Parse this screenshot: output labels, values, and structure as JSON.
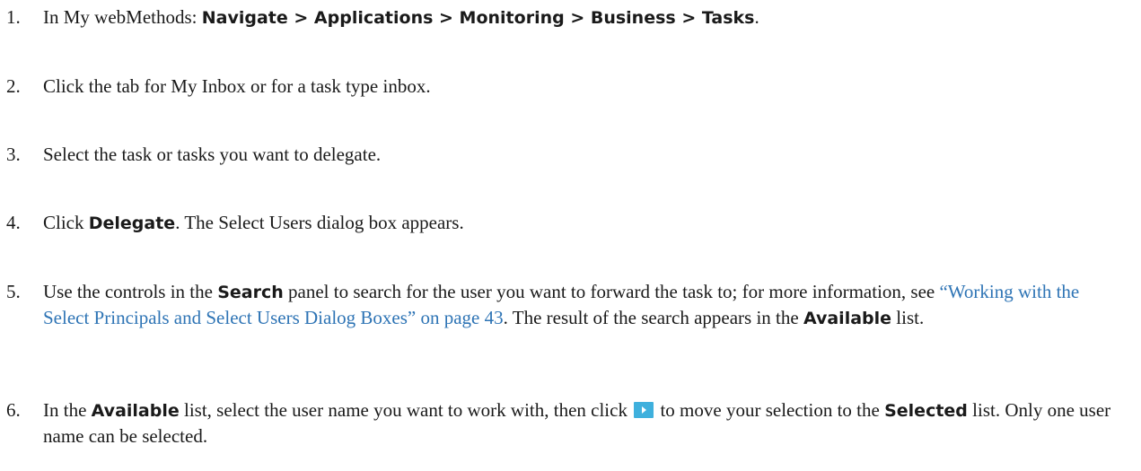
{
  "steps": [
    {
      "num": "1.",
      "t1": "In My webMethods: ",
      "path": "Navigate > Applications > Monitoring > Business > Tasks",
      "t2": "."
    },
    {
      "num": "2.",
      "t1": "Click the tab for My Inbox or for a task type inbox."
    },
    {
      "num": "3.",
      "t1": "Select the task or tasks you want to delegate."
    },
    {
      "num": "4.",
      "t1": "Click ",
      "ui1": "Delegate",
      "t2": ". The Select Users dialog box appears."
    },
    {
      "num": "5.",
      "t1": "Use the controls in the ",
      "ui1": "Search",
      "t2": " panel to search for the user you want to forward the task to; for more information, see ",
      "link": "“Working with the Select Principals and Select Users Dialog Boxes” on page 43",
      "t3": ". The result of the search appears in the ",
      "ui2": "Available",
      "t4": " list."
    },
    {
      "num": "6.",
      "t1": "In the ",
      "ui1": "Available",
      "t2": " list, select the user name you want to work with, then click ",
      "icon": "move-right-arrow-icon",
      "t3": " to move your selection to the ",
      "ui2": "Selected",
      "t4": " list. Only one user name can be selected."
    }
  ],
  "colors": {
    "link": "#2e74b5",
    "icon_bg": "#3fb0dd",
    "text": "#1a1a1a"
  }
}
